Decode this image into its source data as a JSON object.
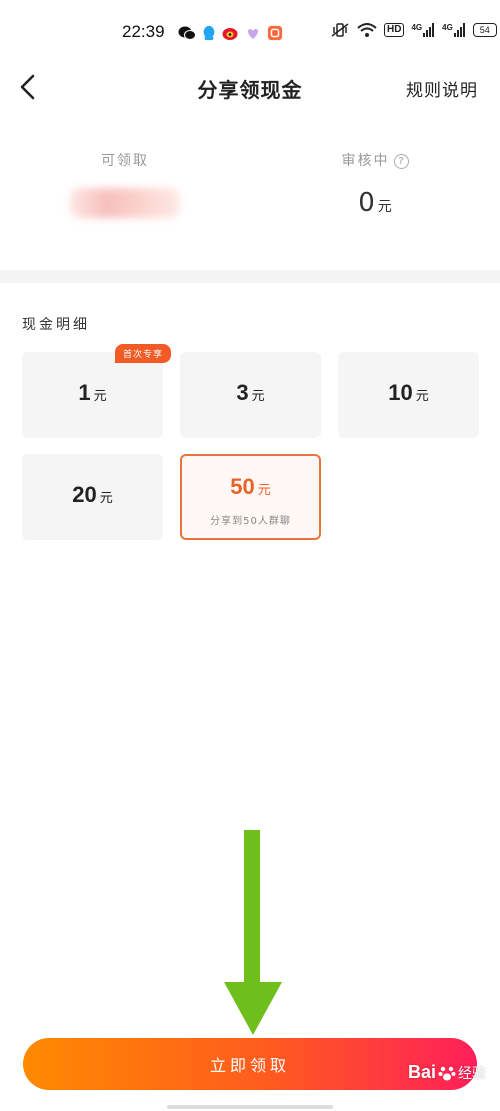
{
  "status_bar": {
    "time": "22:39",
    "network": [
      "4G",
      "4G"
    ],
    "hd_badge": "HD",
    "battery": "54"
  },
  "header": {
    "title": "分享领现金",
    "rules_link": "规则说明"
  },
  "summary": {
    "available_label": "可领取",
    "reviewing_label": "审核中",
    "reviewing_value": "0",
    "unit": "元"
  },
  "cash_section": {
    "title": "现金明细",
    "options": [
      {
        "amount": "1",
        "unit": "元",
        "tag": "首次专享",
        "selected": false
      },
      {
        "amount": "3",
        "unit": "元",
        "selected": false
      },
      {
        "amount": "10",
        "unit": "元",
        "selected": false
      },
      {
        "amount": "20",
        "unit": "元",
        "selected": false
      },
      {
        "amount": "50",
        "unit": "元",
        "subtitle": "分享到50人群聊",
        "selected": true
      }
    ]
  },
  "claim_button": {
    "label": "立即领取"
  },
  "watermark": {
    "brand": "Bai",
    "sub": "经验"
  },
  "colors": {
    "accent": "#e8632a",
    "tag": "#f25b26",
    "button_start": "#ff8a00",
    "button_end": "#ff1f5a",
    "arrow": "#6ebf1c"
  }
}
